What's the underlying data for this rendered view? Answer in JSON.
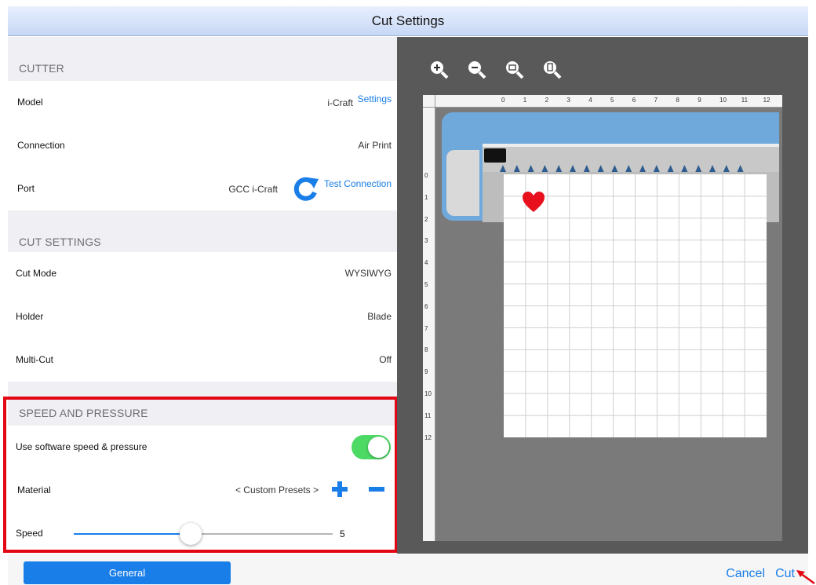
{
  "window": {
    "title": "Cut Settings"
  },
  "cutter": {
    "header": "CUTTER",
    "model_label": "Model",
    "model_value": "i-Craft",
    "settings_link": "Settings",
    "connection_label": "Connection",
    "connection_value": "Air Print",
    "port_label": "Port",
    "port_value": "GCC i-Craft",
    "test_connection_link": "Test Connection"
  },
  "cut_settings": {
    "header": "CUT SETTINGS",
    "cut_mode_label": "Cut Mode",
    "cut_mode_value": "WYSIWYG",
    "holder_label": "Holder",
    "holder_value": "Blade",
    "multicut_label": "Multi-Cut",
    "multicut_value": "Off"
  },
  "speed_pressure": {
    "header": "SPEED AND PRESSURE",
    "software_label": "Use software speed & pressure",
    "software_on": true,
    "material_label": "Material",
    "material_value": "< Custom Presets >",
    "speed_label": "Speed",
    "speed_value": "5",
    "speed_fraction": 0.45
  },
  "preview": {
    "zoom_icons": [
      "zoom-in-icon",
      "zoom-out-icon",
      "zoom-fit-icon",
      "zoom-page-icon"
    ],
    "ruler_top": [
      "0",
      "1",
      "2",
      "3",
      "4",
      "5",
      "6",
      "7",
      "8",
      "9",
      "10",
      "11",
      "12"
    ],
    "ruler_left": [
      "0",
      "1",
      "2",
      "3",
      "4",
      "5",
      "6",
      "7",
      "8",
      "9",
      "10",
      "11",
      "12"
    ],
    "design_shape": "heart",
    "design_color": "#e8101c"
  },
  "bottom": {
    "general_button": "General",
    "cancel_link": "Cancel",
    "cut_link": "Cut"
  },
  "colors": {
    "accent": "#1a7ee8",
    "highlight": "#e30613",
    "toggle_on": "#4cd964"
  }
}
